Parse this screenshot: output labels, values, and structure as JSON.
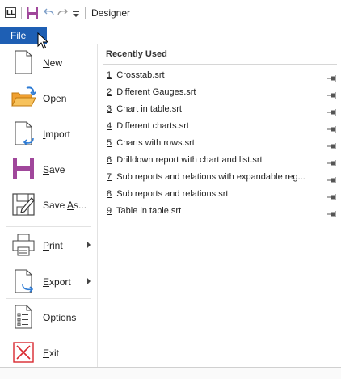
{
  "window": {
    "title": "Designer"
  },
  "quick_access": {
    "app_icon_label": "LL",
    "icons": [
      "app-icon",
      "save-icon",
      "undo-icon",
      "redo-icon",
      "customize-quick-access-icon"
    ]
  },
  "ribbon": {
    "file_tab": "File"
  },
  "nav": {
    "items": [
      {
        "label": "New",
        "accel": "N",
        "icon": "new-document-icon"
      },
      {
        "label": "Open",
        "accel": "O",
        "icon": "open-folder-icon"
      },
      {
        "label": "Import",
        "accel": "I",
        "icon": "import-icon"
      },
      {
        "label": "Save",
        "accel": "S",
        "icon": "save-icon"
      },
      {
        "label": "Save As...",
        "accel": "A",
        "icon": "save-as-icon"
      },
      {
        "label": "Print",
        "accel": "P",
        "icon": "print-icon",
        "submenu": true
      },
      {
        "label": "Export",
        "accel": "E",
        "icon": "export-icon",
        "submenu": true
      },
      {
        "label": "Options",
        "accel": "O",
        "icon": "options-icon"
      },
      {
        "label": "Exit",
        "accel": "E",
        "icon": "exit-icon"
      }
    ]
  },
  "recent": {
    "heading": "Recently Used",
    "items": [
      {
        "num": "1",
        "name": "Crosstab.srt"
      },
      {
        "num": "2",
        "name": "Different Gauges.srt"
      },
      {
        "num": "3",
        "name": "Chart in table.srt"
      },
      {
        "num": "4",
        "name": "Different charts.srt"
      },
      {
        "num": "5",
        "name": "Charts with rows.srt"
      },
      {
        "num": "6",
        "name": "Drilldown report with chart and list.srt"
      },
      {
        "num": "7",
        "name": "Sub reports and relations with expandable reg..."
      },
      {
        "num": "8",
        "name": "Sub reports and relations.srt"
      },
      {
        "num": "9",
        "name": "Table in table.srt"
      }
    ]
  },
  "colors": {
    "file_tab": "#1e5fb4",
    "save_purple": "#a0479b",
    "folder_orange": "#f0a030",
    "import_blue": "#2d7bd4",
    "exit_red": "#d9282f"
  }
}
